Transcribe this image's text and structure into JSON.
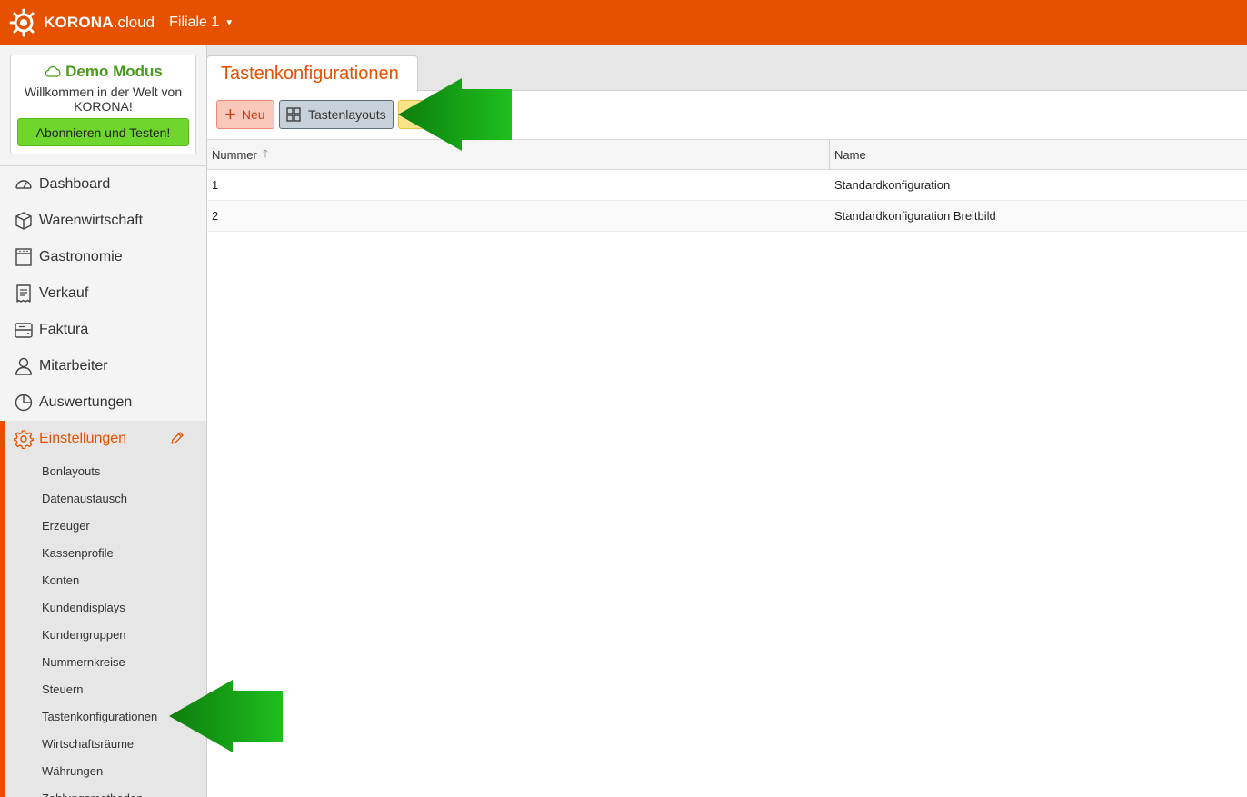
{
  "header": {
    "logo_bold": "KORONA",
    "logo_suffix": ".cloud",
    "branch": "Filiale 1"
  },
  "demo": {
    "title": "Demo Modus",
    "text": "Willkommen in der Welt von KORONA!",
    "button": "Abonnieren und Testen!"
  },
  "nav": {
    "items": [
      {
        "label": "Dashboard"
      },
      {
        "label": "Warenwirtschaft"
      },
      {
        "label": "Gastronomie"
      },
      {
        "label": "Verkauf"
      },
      {
        "label": "Faktura"
      },
      {
        "label": "Mitarbeiter"
      },
      {
        "label": "Auswertungen"
      },
      {
        "label": "Einstellungen"
      }
    ],
    "sub_items": [
      "Bonlayouts",
      "Datenaustausch",
      "Erzeuger",
      "Kassenprofile",
      "Konten",
      "Kundendisplays",
      "Kundengruppen",
      "Nummernkreise",
      "Steuern",
      "Tastenkonfigurationen",
      "Wirtschaftsräume",
      "Währungen",
      "Zahlungsmethoden"
    ]
  },
  "tab": {
    "title": "Tastenkonfigurationen"
  },
  "toolbar": {
    "new_label": "Neu",
    "layouts_label": "Tastenlayouts"
  },
  "table": {
    "columns": [
      "Nummer",
      "Name"
    ],
    "rows": [
      {
        "number": "1",
        "name": "Standardkonfiguration"
      },
      {
        "number": "2",
        "name": "Standardkonfiguration Breitbild"
      }
    ]
  },
  "colors": {
    "brand": "#e65100",
    "demo_green": "#4a9a1c",
    "arrow_green": "#1aa51a"
  }
}
